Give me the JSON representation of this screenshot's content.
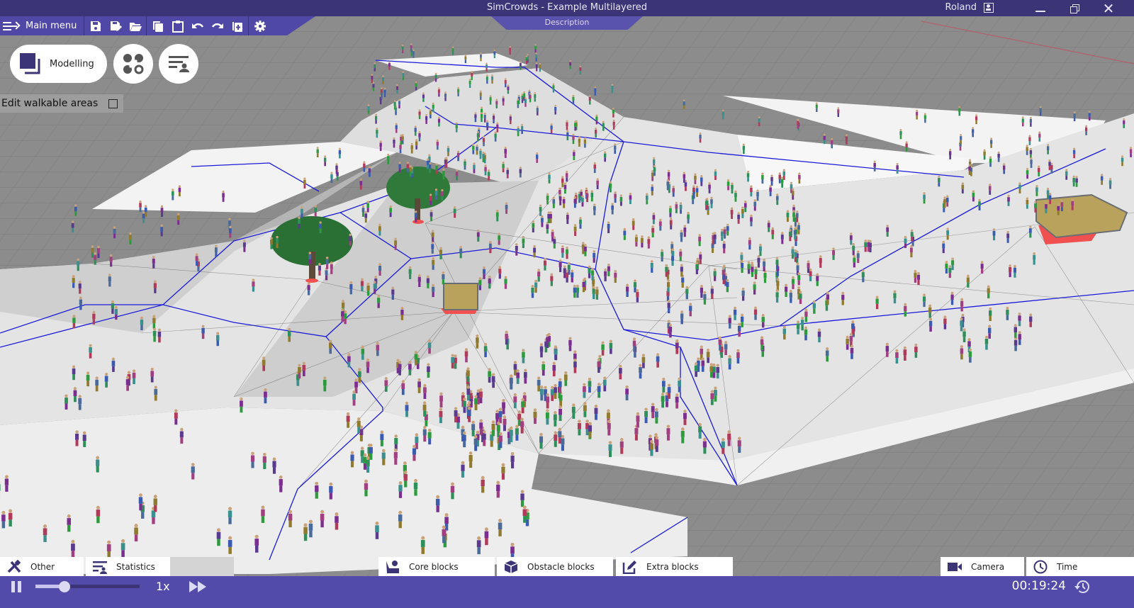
{
  "window": {
    "title": "SimCrowds - Example Multilayered",
    "user": "Roland",
    "description_tab": "Description",
    "controls": [
      "minimize",
      "maximize",
      "close"
    ]
  },
  "toolbar": {
    "main_menu_label": "Main menu",
    "file_icons": [
      "save-icon",
      "save-as-icon",
      "open-folder-icon"
    ],
    "edit_icons": [
      "copy-icon",
      "paste-icon",
      "undo-icon",
      "redo-icon",
      "add-copy-icon"
    ],
    "settings_icon": "gear-icon"
  },
  "modes": {
    "active_label": "Modelling",
    "buttons": [
      {
        "name": "modelling",
        "label": "Modelling",
        "icon": "modelling-icon"
      },
      {
        "name": "graph",
        "icon": "graph-nodes-icon"
      },
      {
        "name": "agents-list",
        "icon": "list-person-icon"
      }
    ]
  },
  "edit_walkable": {
    "label": "Edit walkable areas",
    "checked": false
  },
  "bottom_tabs": {
    "other": "Other",
    "statistics": "Statistics",
    "core_blocks": "Core blocks",
    "obstacle_blocks": "Obstacle blocks",
    "extra_blocks": "Extra blocks",
    "camera": "Camera",
    "time": "Time"
  },
  "playback": {
    "state": "playing",
    "speed_label": "1x",
    "speed_slider_fraction": 0.28,
    "elapsed_time": "00:19:24"
  },
  "scene": {
    "description": "3D crowd simulation view with walkable areas, navigation mesh, trees and sandbag obstacles",
    "colors": {
      "ground": "#8a8a8a",
      "walkable": "#f2f2f2",
      "navmesh_edge": "#1a1adb",
      "obstacle_marker": "#f05050",
      "tree": "#2f7a3a",
      "sandbag": "#b8a25c"
    }
  },
  "theme": {
    "titlebar": "#3b3578",
    "toolbar": "#4f48a6",
    "playbar": "#524ba9",
    "accent_icon": "#3b3578"
  }
}
